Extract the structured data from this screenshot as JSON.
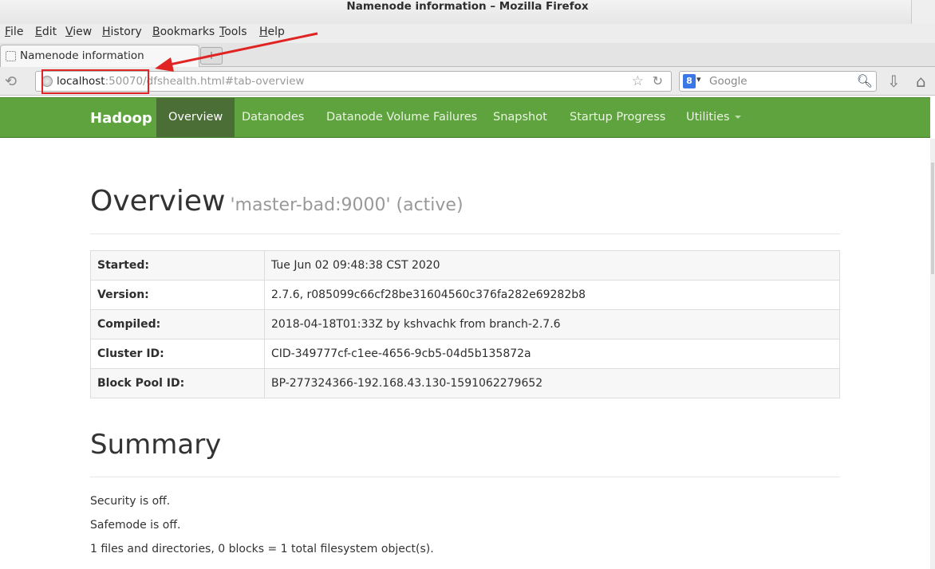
{
  "window": {
    "title": "Namenode information – Mozilla Firefox"
  },
  "menu": {
    "items": [
      "File",
      "Edit",
      "View",
      "History",
      "Bookmarks",
      "Tools",
      "Help"
    ]
  },
  "tab": {
    "title": "Namenode information",
    "newtab_label": "+"
  },
  "url": {
    "host": "localhost",
    "rest": ":50070/dfshealth.html#tab-overview"
  },
  "search": {
    "placeholder": "Google",
    "engine_letter": "8"
  },
  "icons": {
    "back": "back-arrow-icon",
    "globe": "globe-icon",
    "bookmark": "star-icon",
    "reload": "reload-icon",
    "search": "magnifier-icon",
    "download": "download-icon",
    "home": "home-icon"
  },
  "hadoop_nav": {
    "brand": "Hadoop",
    "items": [
      "Overview",
      "Datanodes",
      "Datanode Volume Failures",
      "Snapshot",
      "Startup Progress",
      "Utilities"
    ],
    "active": "Overview"
  },
  "overview": {
    "title": "Overview",
    "subtitle": "'master-bad:9000' (active)",
    "rows": [
      {
        "key": "Started:",
        "value": "Tue Jun 02 09:48:38 CST 2020"
      },
      {
        "key": "Version:",
        "value": "2.7.6, r085099c66cf28be31604560c376fa282e69282b8"
      },
      {
        "key": "Compiled:",
        "value": "2018-04-18T01:33Z by kshvachk from branch-2.7.6"
      },
      {
        "key": "Cluster ID:",
        "value": "CID-349777cf-c1ee-4656-9cb5-04d5b135872a"
      },
      {
        "key": "Block Pool ID:",
        "value": "BP-277324366-192.168.43.130-1591062279652"
      }
    ]
  },
  "summary": {
    "title": "Summary",
    "lines": [
      "Security is off.",
      "Safemode is off.",
      "1 files and directories, 0 blocks = 1 total filesystem object(s)."
    ]
  },
  "colors": {
    "hadoop_green": "#5ea33e",
    "active_tab": "#4a6e35",
    "annotation": "#e02424"
  }
}
